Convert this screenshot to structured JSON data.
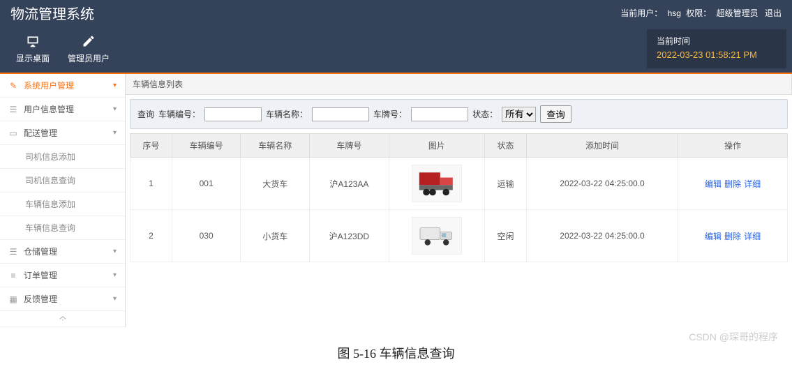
{
  "header": {
    "title": "物流管理系统",
    "current_user_label": "当前用户：",
    "current_user": "hsg",
    "role_label": "权限：",
    "role": "超级管理员",
    "logout": "退出"
  },
  "toolbar": {
    "desktop": "显示桌面",
    "admin_user": "管理员用户",
    "time_label": "当前时间",
    "time_value": "2022-03-23 01:58:21 PM"
  },
  "sidebar": {
    "items": [
      {
        "label": "系统用户管理",
        "active": true,
        "open": true
      },
      {
        "label": "用户信息管理"
      },
      {
        "label": "配送管理",
        "open": true,
        "children": [
          "司机信息添加",
          "司机信息查询",
          "车辆信息添加",
          "车辆信息查询"
        ]
      },
      {
        "label": "仓储管理"
      },
      {
        "label": "订单管理"
      },
      {
        "label": "反馈管理"
      }
    ]
  },
  "panel": {
    "title": "车辆信息列表"
  },
  "search": {
    "prefix": "查询",
    "code_label": "车辆编号：",
    "name_label": "车辆名称：",
    "plate_label": "车牌号：",
    "status_label": "状态：",
    "status_value": "所有",
    "button": "查询"
  },
  "table": {
    "headers": [
      "序号",
      "车辆编号",
      "车辆名称",
      "车牌号",
      "图片",
      "状态",
      "添加时间",
      "操作"
    ],
    "actions": {
      "edit": "编辑",
      "delete": "删除",
      "detail": "详细"
    },
    "rows": [
      {
        "idx": "1",
        "code": "001",
        "name": "大货车",
        "plate": "沪A123AA",
        "truck": "big",
        "status": "运输",
        "time": "2022-03-22 04:25:00.0"
      },
      {
        "idx": "2",
        "code": "030",
        "name": "小货车",
        "plate": "沪A123DD",
        "truck": "small",
        "status": "空闲",
        "time": "2022-03-22 04:25:00.0"
      }
    ]
  },
  "caption": "图 5-16 车辆信息查询",
  "watermark": "CSDN @琛哥的程序"
}
